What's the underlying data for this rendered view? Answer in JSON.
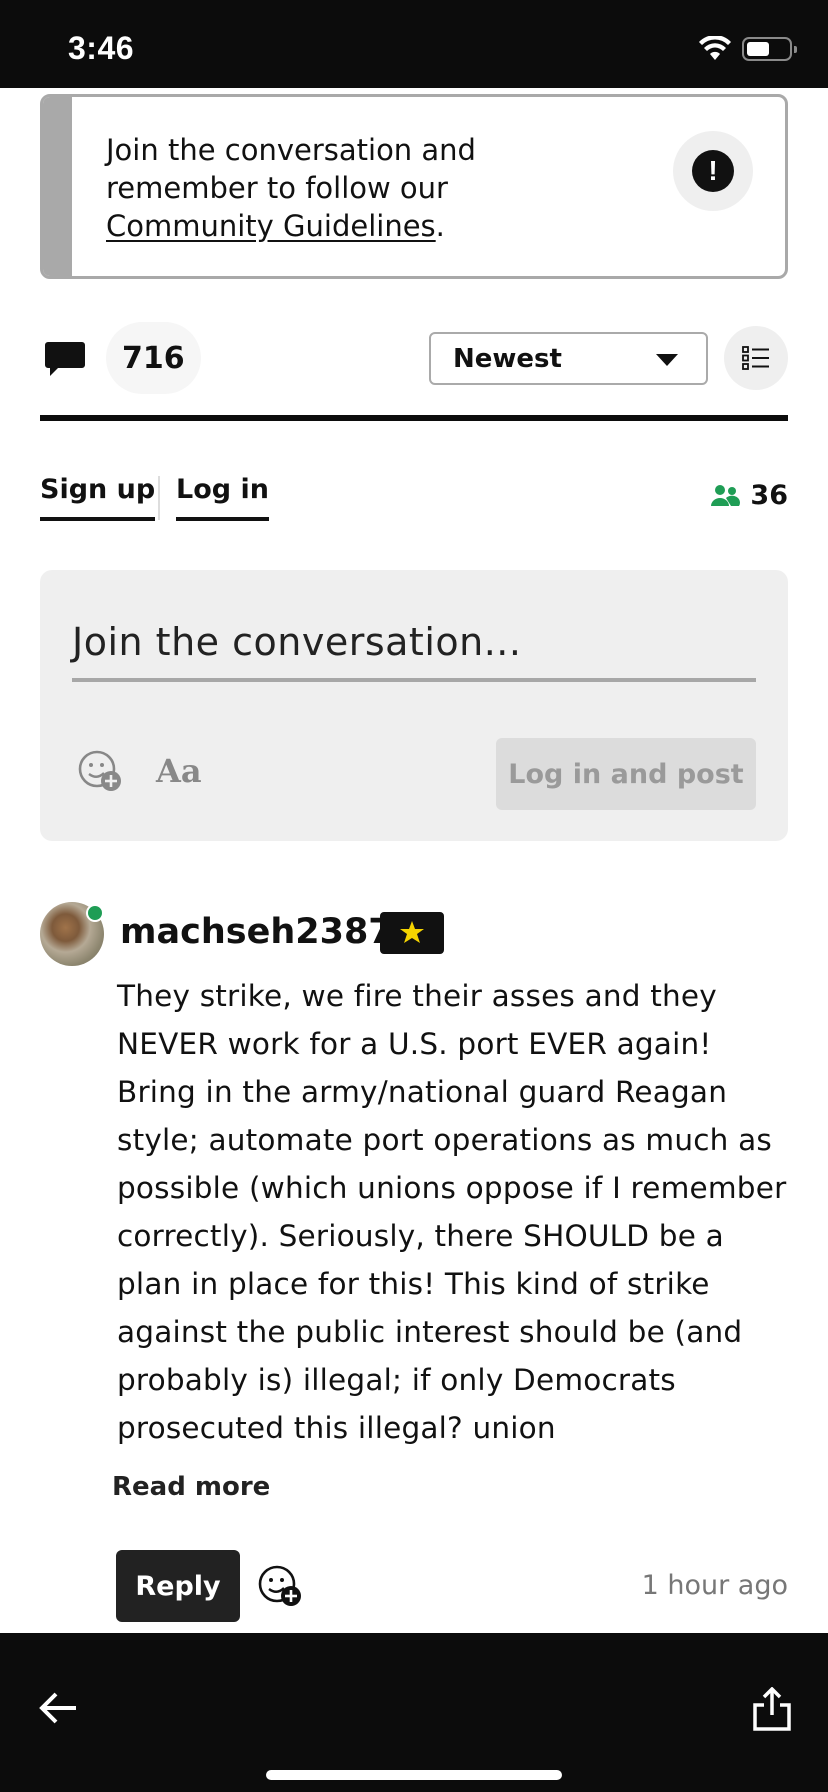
{
  "status_bar": {
    "time": "3:46",
    "icons": [
      "wifi-icon",
      "battery-icon"
    ]
  },
  "guidelines": {
    "text_before": "Join the conversation and remember to follow our ",
    "link": "Community Guidelines",
    "text_after": ".",
    "icon": "exclamation-icon"
  },
  "comments_header": {
    "count": "716",
    "sort_selected": "Newest",
    "icons": [
      "speech-bubble-icon",
      "list-icon"
    ]
  },
  "auth": {
    "sign_up": "Sign up",
    "log_in": "Log in",
    "viewer_count": "36"
  },
  "composer": {
    "placeholder": "Join the conversation...",
    "font_button": "Aa",
    "post_button": "Log in and post"
  },
  "comment": {
    "username": "machseh2387",
    "body": "They strike, we fire their asses and they NEVER work for a U.S. port EVER again! Bring in the army/national guard Reagan style; automate port operations as much as possible (which unions oppose if I remember correctly). Seriously, there SHOULD be a plan in place for this! This kind of strike against the public interest should be (and probably is) illegal; if only Democrats prosecuted this illegal? union",
    "read_more": "Read more",
    "reply": "Reply",
    "timestamp": "1 hour ago"
  },
  "colors": {
    "online": "#1f9d55",
    "badge_star": "#f5d400",
    "dark": "#0c0c0c"
  }
}
